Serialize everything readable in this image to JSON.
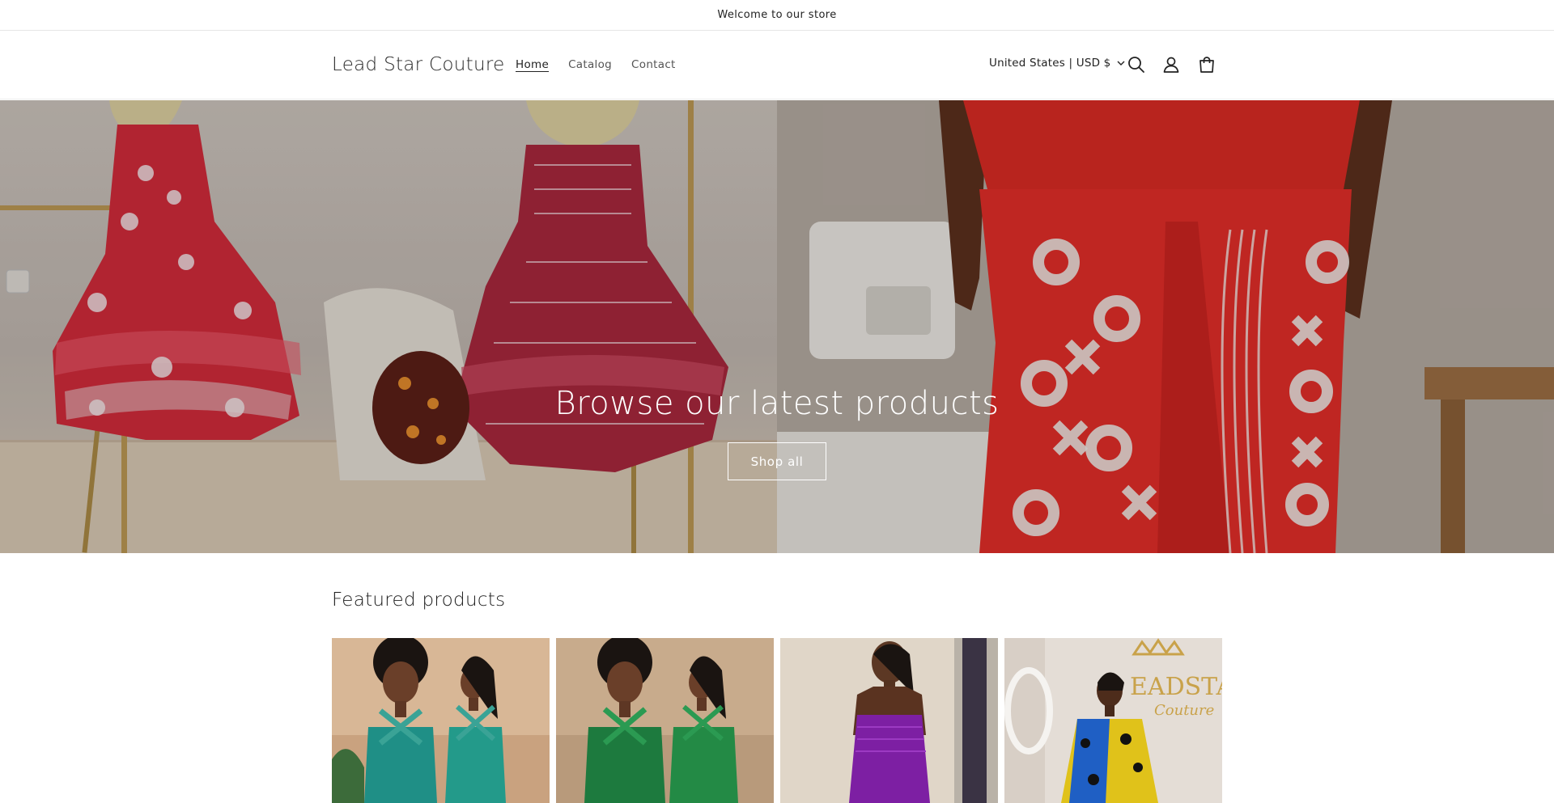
{
  "announcement": {
    "text": "Welcome to our store"
  },
  "header": {
    "logo": "Lead Star Couture",
    "nav": [
      {
        "label": "Home",
        "active": true
      },
      {
        "label": "Catalog",
        "active": false
      },
      {
        "label": "Contact",
        "active": false
      }
    ],
    "locale": "United States | USD $",
    "icons": [
      "search-icon",
      "account-icon",
      "cart-icon"
    ]
  },
  "hero": {
    "title": "Browse our latest products",
    "button_label": "Shop all"
  },
  "featured": {
    "title": "Featured products",
    "products": [
      {
        "image": "two-women-teal-halter-tops"
      },
      {
        "image": "two-women-green-halter-tops"
      },
      {
        "image": "woman-purple-smocked-dress"
      },
      {
        "image": "woman-yellow-blue-print-shirt",
        "sign_text": "LEADSTAR Couture"
      }
    ]
  },
  "colors": {
    "text": "#121212",
    "border": "#e6e6e6",
    "hero_text": "#ffffff"
  }
}
